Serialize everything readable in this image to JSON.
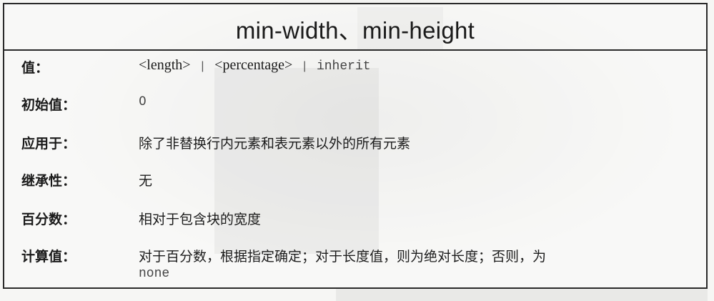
{
  "title": "min-width、min-height",
  "rows": [
    {
      "label": "值：",
      "value_parts": [
        "<length>",
        "|",
        "<percentage>",
        "|",
        "inherit"
      ]
    },
    {
      "label": "初始值：",
      "value": "0"
    },
    {
      "label": "应用于：",
      "value": "除了非替换行内元素和表元素以外的所有元素"
    },
    {
      "label": "继承性：",
      "value": "无"
    },
    {
      "label": "百分数：",
      "value": "相对于包含块的宽度"
    },
    {
      "label": "计算值：",
      "value_line1": "对于百分数，根据指定确定；对于长度值，则为绝对长度；否则，为",
      "value_line2": "none"
    }
  ]
}
